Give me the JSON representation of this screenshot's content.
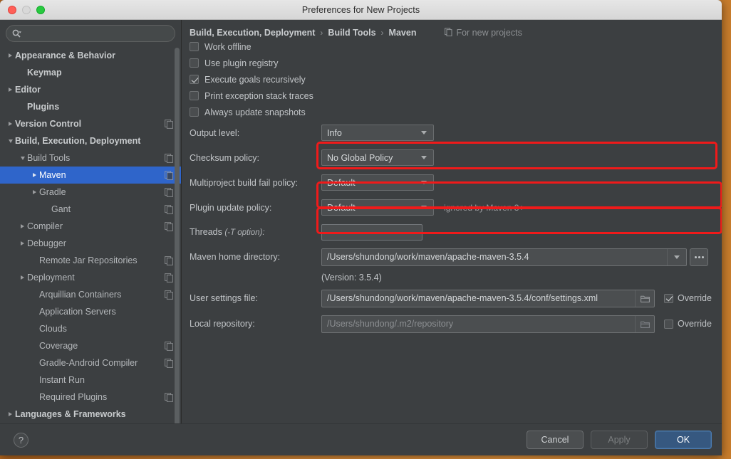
{
  "window": {
    "title": "Preferences for New Projects",
    "traffic_lights": [
      "close",
      "minimize",
      "maximize"
    ]
  },
  "sidebar": {
    "search": {
      "value": "",
      "placeholder": ""
    },
    "items": [
      {
        "label": "Appearance & Behavior",
        "indent": 0,
        "twisty": "right",
        "bold": true,
        "copy": false,
        "selected": false
      },
      {
        "label": "Keymap",
        "indent": 1,
        "twisty": "none",
        "bold": true,
        "copy": false,
        "selected": false
      },
      {
        "label": "Editor",
        "indent": 0,
        "twisty": "right",
        "bold": true,
        "copy": false,
        "selected": false
      },
      {
        "label": "Plugins",
        "indent": 1,
        "twisty": "none",
        "bold": true,
        "copy": false,
        "selected": false
      },
      {
        "label": "Version Control",
        "indent": 0,
        "twisty": "right",
        "bold": true,
        "copy": true,
        "selected": false
      },
      {
        "label": "Build, Execution, Deployment",
        "indent": 0,
        "twisty": "down",
        "bold": true,
        "copy": false,
        "selected": false
      },
      {
        "label": "Build Tools",
        "indent": 1,
        "twisty": "down",
        "bold": false,
        "copy": true,
        "selected": false
      },
      {
        "label": "Maven",
        "indent": 2,
        "twisty": "right",
        "bold": false,
        "copy": true,
        "selected": true
      },
      {
        "label": "Gradle",
        "indent": 2,
        "twisty": "right",
        "bold": false,
        "copy": true,
        "selected": false
      },
      {
        "label": "Gant",
        "indent": 3,
        "twisty": "none",
        "bold": false,
        "copy": true,
        "selected": false
      },
      {
        "label": "Compiler",
        "indent": 1,
        "twisty": "right",
        "bold": false,
        "copy": true,
        "selected": false
      },
      {
        "label": "Debugger",
        "indent": 1,
        "twisty": "right",
        "bold": false,
        "copy": false,
        "selected": false
      },
      {
        "label": "Remote Jar Repositories",
        "indent": 2,
        "twisty": "none",
        "bold": false,
        "copy": true,
        "selected": false
      },
      {
        "label": "Deployment",
        "indent": 1,
        "twisty": "right",
        "bold": false,
        "copy": true,
        "selected": false
      },
      {
        "label": "Arquillian Containers",
        "indent": 2,
        "twisty": "none",
        "bold": false,
        "copy": true,
        "selected": false
      },
      {
        "label": "Application Servers",
        "indent": 2,
        "twisty": "none",
        "bold": false,
        "copy": false,
        "selected": false
      },
      {
        "label": "Clouds",
        "indent": 2,
        "twisty": "none",
        "bold": false,
        "copy": false,
        "selected": false
      },
      {
        "label": "Coverage",
        "indent": 2,
        "twisty": "none",
        "bold": false,
        "copy": true,
        "selected": false
      },
      {
        "label": "Gradle-Android Compiler",
        "indent": 2,
        "twisty": "none",
        "bold": false,
        "copy": true,
        "selected": false
      },
      {
        "label": "Instant Run",
        "indent": 2,
        "twisty": "none",
        "bold": false,
        "copy": false,
        "selected": false
      },
      {
        "label": "Required Plugins",
        "indent": 2,
        "twisty": "none",
        "bold": false,
        "copy": true,
        "selected": false
      },
      {
        "label": "Languages & Frameworks",
        "indent": 0,
        "twisty": "right",
        "bold": true,
        "copy": false,
        "selected": false
      }
    ]
  },
  "breadcrumb": {
    "crumbs": [
      "Build, Execution, Deployment",
      "Build Tools",
      "Maven"
    ],
    "separator": "›",
    "scope_badge": "For new projects"
  },
  "checkboxes": [
    {
      "label": "Work offline",
      "checked": false
    },
    {
      "label": "Use plugin registry",
      "checked": false
    },
    {
      "label": "Execute goals recursively",
      "checked": true
    },
    {
      "label": "Print exception stack traces",
      "checked": false
    },
    {
      "label": "Always update snapshots",
      "checked": false
    }
  ],
  "combos": [
    {
      "label": "Output level:",
      "value": "Info",
      "note": ""
    },
    {
      "label": "Checksum policy:",
      "value": "No Global Policy",
      "note": ""
    },
    {
      "label": "Multiproject build fail policy:",
      "value": "Default",
      "note": ""
    },
    {
      "label": "Plugin update policy:",
      "value": "Default",
      "note": "ignored by Maven 3+"
    }
  ],
  "threads": {
    "label_main": "Threads ",
    "label_hint": "(-T option):",
    "value": ""
  },
  "maven_home": {
    "label": "Maven home directory:",
    "value": "/Users/shundong/work/maven/apache-maven-3.5.4",
    "version_note": "(Version: 3.5.4)",
    "browse_button": "..."
  },
  "user_settings": {
    "label": "User settings file:",
    "value": "/Users/shundong/work/maven/apache-maven-3.5.4/conf/settings.xml",
    "override_label": "Override",
    "override_checked": true
  },
  "local_repository": {
    "label": "Local repository:",
    "value": "/Users/shundong/.m2/repository",
    "is_placeholder": true,
    "override_label": "Override",
    "override_checked": false
  },
  "footer": {
    "help": "?",
    "cancel": "Cancel",
    "apply": "Apply",
    "ok": "OK"
  },
  "colors": {
    "accent_selection": "#2f65ca",
    "primary_button": "#365880",
    "annotation_red": "#f01a1a",
    "panel_bg": "#3c3f41",
    "desktop_orange": "#d98a37"
  }
}
